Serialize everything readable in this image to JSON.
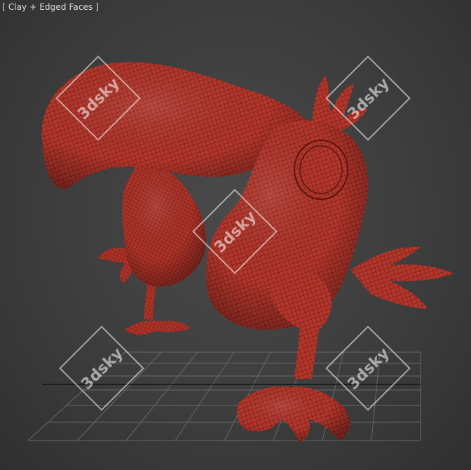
{
  "viewport": {
    "label": "[ Clay + Edged Faces ]",
    "render_mode": "Clay + Edged Faces",
    "background_color": "#3c3c3c",
    "model_color": "#b0352b",
    "wire_color": "#4a0f0c",
    "grid_color": "#6a6a6a"
  },
  "watermarks": [
    {
      "text": "3dsky"
    },
    {
      "text": "3dsky"
    },
    {
      "text": "3dsky"
    },
    {
      "text": "3dsky"
    },
    {
      "text": "3dsky"
    }
  ]
}
